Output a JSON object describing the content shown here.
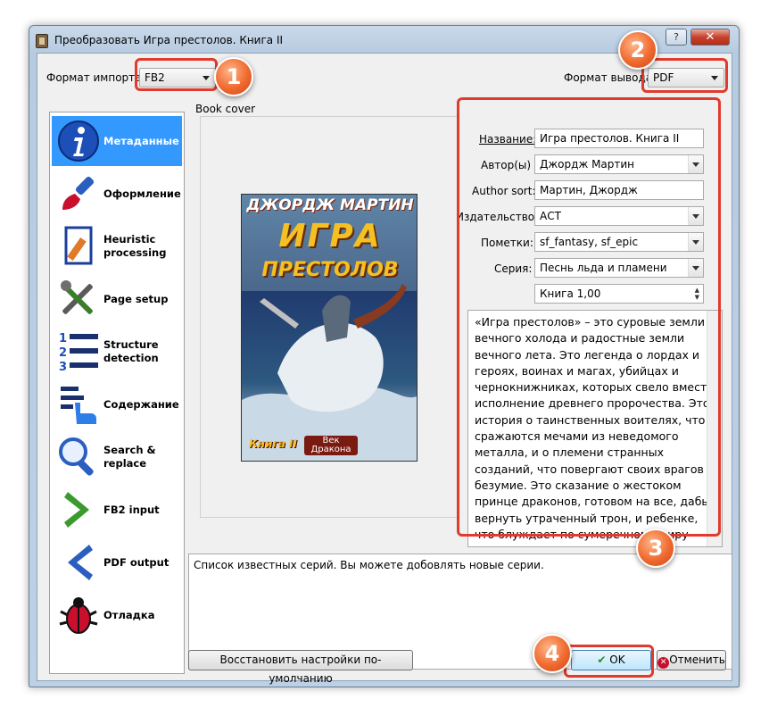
{
  "window": {
    "title": "Преобразовать Игра престолов. Книга II",
    "help_label": "?",
    "close_label": "✕"
  },
  "import": {
    "label": "Формат импорта:",
    "value": "FB2"
  },
  "output": {
    "label": "Формат вывода:",
    "value": "PDF"
  },
  "sidebar": {
    "items": [
      {
        "label": "Метаданные",
        "icon": "info-icon"
      },
      {
        "label": "Оформление",
        "icon": "brush-icon"
      },
      {
        "label": "Heuristic\nprocessing",
        "icon": "document-wand-icon"
      },
      {
        "label": "Page setup",
        "icon": "tools-icon"
      },
      {
        "label": "Structure\ndetection",
        "icon": "numbered-list-icon"
      },
      {
        "label": "Содержание",
        "icon": "toc-hand-icon"
      },
      {
        "label": "Search &\nreplace",
        "icon": "magnifier-icon"
      },
      {
        "label": "FB2 input",
        "icon": "chevron-right-green-icon"
      },
      {
        "label": "PDF output",
        "icon": "chevron-left-blue-icon"
      },
      {
        "label": "Отладка",
        "icon": "bug-icon"
      }
    ]
  },
  "cover": {
    "group_label": "Book cover",
    "author": "ДЖОРДЖ МАРТИН",
    "title_line1": "ИГРА",
    "title_line2": "ПРЕСТОЛОВ",
    "book_label": "Книга II",
    "publisher": "Век\nДракона"
  },
  "meta": {
    "title_label": "Название:",
    "title_value": "Игра престолов. Книга II",
    "authors_label": "Автор(ы)",
    "authors_value": "Джордж Мартин",
    "author_sort_label": "Author sort:",
    "author_sort_value": "Мартин, Джордж",
    "publisher_label": "Издательство:",
    "publisher_value": "АСТ",
    "tags_label": "Пометки:",
    "tags_value": "sf_fantasy, sf_epic",
    "series_label": "Серия:",
    "series_value": "Песнь льда и пламени",
    "series_index": "Книга 1,00"
  },
  "description": "«Игра престолов» – это суровые земли вечного холода и радостные земли вечного лета. Это легенда о лордах и героях, воинах и магах, убийцах и чернокнижниках, которых свело вместе исполнение древнего пророчества. Это история о таинственных воителях, что сражаются мечами из неведомого металла, и о племени странных созданий, что повергают своих врагов в безумие. Это сказание о жестоком принце драконов, готовом на все, дабы вернуть утраченный трон, и ребенке, что блуждает по сумеречному миру меж жизнью и смертью. Это трагедии и",
  "hint": "Список известных серий. Вы можете добовлять новые серии.",
  "buttons": {
    "restore": "Восстановить настройки по-умолчанию",
    "ok": "OK",
    "cancel": "Отменить"
  },
  "badges": [
    "1",
    "2",
    "3",
    "4"
  ],
  "colors": {
    "callout": "#e03b2e",
    "badge": "#f06a2f",
    "selected": "#3399ff"
  }
}
